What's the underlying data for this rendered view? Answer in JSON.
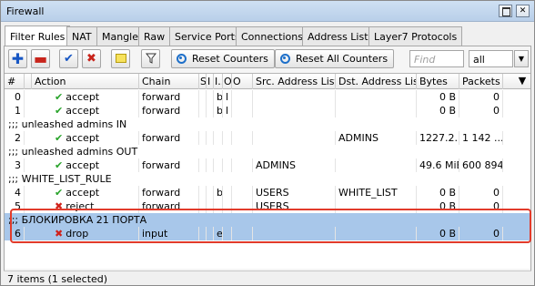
{
  "window": {
    "title": "Firewall"
  },
  "tabs": [
    {
      "label": "Filter Rules"
    },
    {
      "label": "NAT"
    },
    {
      "label": "Mangle"
    },
    {
      "label": "Raw"
    },
    {
      "label": "Service Ports"
    },
    {
      "label": "Connections"
    },
    {
      "label": "Address Lists"
    },
    {
      "label": "Layer7 Protocols"
    }
  ],
  "toolbar": {
    "icons": [
      "plus-icon",
      "minus-icon",
      "check-icon",
      "x-icon",
      "note-icon",
      "filter-icon"
    ],
    "reset_counters": "Reset Counters",
    "reset_all_counters": "Reset All Counters",
    "find_placeholder": "Find",
    "filter_select_value": "all"
  },
  "columns": {
    "num": "#",
    "action": "Action",
    "chain": "Chain",
    "c1": "S",
    "c2": "I",
    "c3": "I..",
    "c4": "O",
    "c5": "O",
    "src": "Src. Address List",
    "dst": "Dst. Address List",
    "bytes": "Bytes",
    "packets": "Packets"
  },
  "rows": [
    {
      "type": "rule",
      "num": "0",
      "action": "accept",
      "action_kind": "accept",
      "chain": "forward",
      "c3": "b",
      "c4": "l",
      "src": "",
      "dst": "",
      "bytes": "0 B",
      "packets": "0"
    },
    {
      "type": "rule",
      "num": "1",
      "action": "accept",
      "action_kind": "accept",
      "chain": "forward",
      "c3": "b",
      "c4": "l",
      "src": "",
      "dst": "",
      "bytes": "0 B",
      "packets": "0"
    },
    {
      "type": "comment",
      "text": ";;; unleashed admins IN"
    },
    {
      "type": "rule",
      "num": "2",
      "action": "accept",
      "action_kind": "accept",
      "chain": "forward",
      "c3": "",
      "c4": "",
      "src": "",
      "dst": "ADMINS",
      "bytes": "1227.2...",
      "packets": "1 142 ..."
    },
    {
      "type": "comment",
      "text": ";;; unleashed admins OUT"
    },
    {
      "type": "rule",
      "num": "3",
      "action": "accept",
      "action_kind": "accept",
      "chain": "forward",
      "c3": "",
      "c4": "",
      "src": "ADMINS",
      "dst": "",
      "bytes": "49.6 MiB",
      "packets": "600 894"
    },
    {
      "type": "comment",
      "text": ";;; WHITE_LIST_RULE"
    },
    {
      "type": "rule",
      "num": "4",
      "action": "accept",
      "action_kind": "accept",
      "chain": "forward",
      "c3": "b",
      "c4": "",
      "src": "USERS",
      "dst": "WHITE_LIST",
      "bytes": "0 B",
      "packets": "0"
    },
    {
      "type": "rule",
      "num": "5",
      "action": "reject",
      "action_kind": "reject",
      "chain": "forward",
      "c3": "",
      "c4": "",
      "src": "USERS",
      "dst": "",
      "bytes": "0 B",
      "packets": "0"
    },
    {
      "type": "comment",
      "text": ";;; БЛОКИРОВКА 21 ПОРТА",
      "selected": true
    },
    {
      "type": "rule",
      "num": "6",
      "action": "drop",
      "action_kind": "reject",
      "chain": "input",
      "c3": "e",
      "c4": "",
      "src": "",
      "dst": "",
      "bytes": "0 B",
      "packets": "0",
      "selected": true
    }
  ],
  "status": {
    "text": "7 items (1 selected)"
  },
  "colors": {
    "selection": "#a8c7ea",
    "highlight_border": "#e23b2b",
    "accept": "#28a32a",
    "reject": "#d0211a"
  }
}
